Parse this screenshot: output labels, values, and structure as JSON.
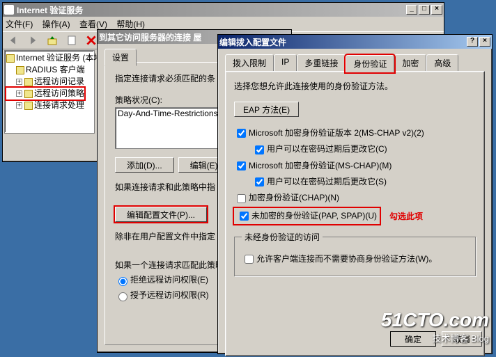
{
  "mainWindow": {
    "title": "Internet 验证服务",
    "menu": {
      "file": "文件(F)",
      "action": "操作(A)",
      "view": "查看(V)",
      "help": "帮助(H)"
    },
    "tree": {
      "root": "Internet 验证服务 (本地)",
      "items": [
        "RADIUS 客户端",
        "远程访问记录",
        "远程访问策略",
        "连接请求处理"
      ]
    }
  },
  "midWindow": {
    "title": "到其它访问服务器的连接 屋",
    "tab": "设置",
    "instruct": "指定连接请求必须匹配的条",
    "condLabel": "策略状况(C):",
    "condValue": "Day-And-Time-Restrictions",
    "btnAdd": "添加(D)...",
    "btnEdit": "编辑(E)",
    "note1": "如果连接请求和此策略中指",
    "btnProfile": "编辑配置文件(P)...",
    "note2": "除非在用户配置文件中指定",
    "note3": "如果一个连接请求匹配此策略指定",
    "radioDeny": "拒绝远程访问权限(E)",
    "radioGrant": "授予远程访问权限(R)"
  },
  "dialog": {
    "title": "编辑拨入配置文件",
    "tabs": [
      "拨入限制",
      "IP",
      "多重链接",
      "身份验证",
      "加密",
      "高级"
    ],
    "intro": "选择您想允许此连接使用的身份验证方法。",
    "btnEAP": "EAP 方法(E)",
    "ck1": "Microsoft 加密身份验证版本 2(MS-CHAP v2)(2)",
    "ck1a": "用户可以在密码过期后更改它(C)",
    "ck2": "Microsoft 加密身份验证(MS-CHAP)(M)",
    "ck2a": "用户可以在密码过期后更改它(S)",
    "ck3": "加密身份验证(CHAP)(N)",
    "ck4": "未加密的身份验证(PAP, SPAP)(U)",
    "annot": "勾选此项",
    "groupTitle": "未经身份验证的访问",
    "ck5": "允许客户端连接而不需要协商身份验证方法(W)。",
    "ok": "确定",
    "cancel": "取消"
  },
  "watermark": {
    "big": "51CTO.com",
    "small": "技术博客  Blog"
  }
}
